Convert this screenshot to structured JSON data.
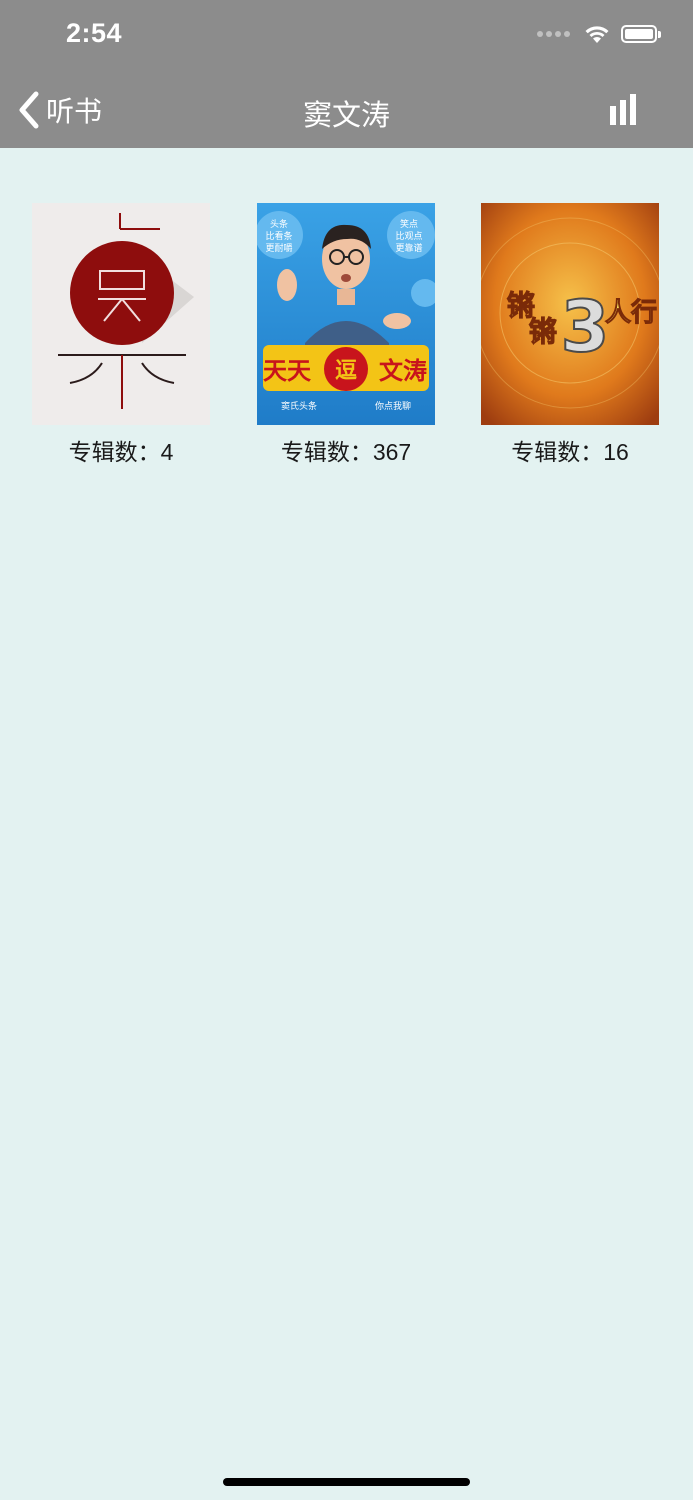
{
  "status_bar": {
    "time": "2:54"
  },
  "nav": {
    "back_label": "听书",
    "title": "窦文涛"
  },
  "albums": [
    {
      "caption": "专辑数：4",
      "cover_text": ""
    },
    {
      "caption": "专辑数：367",
      "cover_text": "天天逗文涛",
      "cover_tags_left": "头条 比看条 更耐嚼",
      "cover_tags_right": "笑点 比观点 更靠谱",
      "cover_footer_left": "窦氏头条",
      "cover_footer_right": "你点我聊"
    },
    {
      "caption": "专辑数：16",
      "cover_text": "锵锵3人行"
    }
  ],
  "colors": {
    "nav_bg": "#8c8c8c",
    "page_bg": "#e3f2f1",
    "cover1_red": "#8e0d0d",
    "cover2_blue": "#2d8fd8",
    "cover3_orange": "#d9731a"
  }
}
